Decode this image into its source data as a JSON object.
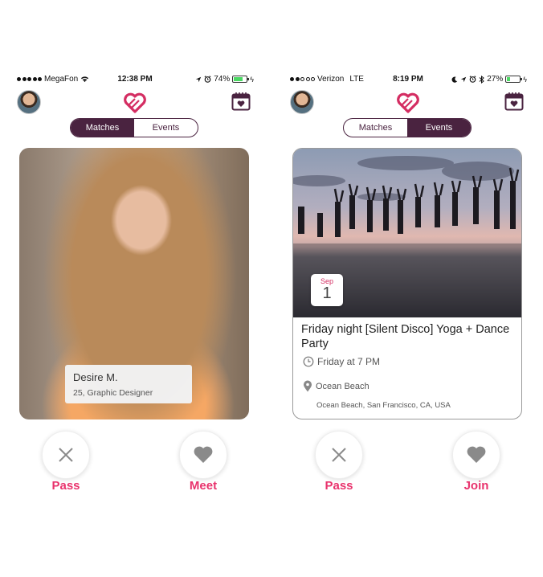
{
  "colors": {
    "brand": "#4a2340",
    "accent": "#e8326c",
    "battery_green": "#4cd964"
  },
  "left": {
    "status": {
      "carrier": "MegaFon",
      "time": "12:38 PM",
      "battery": "74%",
      "battery_level": 0.74
    },
    "segmented": {
      "matches": "Matches",
      "events": "Events",
      "active": "matches"
    },
    "profile": {
      "name": "Desire M.",
      "details": "25, Graphic Designer"
    },
    "actions": {
      "pass_label": "Pass",
      "meet_label": "Meet"
    }
  },
  "right": {
    "status": {
      "carrier": "Verizon",
      "network": "LTE",
      "time": "8:19 PM",
      "battery": "27%",
      "battery_level": 0.27
    },
    "segmented": {
      "matches": "Matches",
      "events": "Events",
      "active": "events"
    },
    "event": {
      "month": "Sep",
      "day": "1",
      "title": "Friday night [Silent Disco] Yoga + Dance Party",
      "time": "Friday at 7 PM",
      "venue": "Ocean Beach",
      "address": "Ocean Beach, San Francisco, CA, USA"
    },
    "actions": {
      "pass_label": "Pass",
      "join_label": "Join"
    }
  },
  "icons": [
    "wifi-icon",
    "location-arrow-icon",
    "alarm-icon",
    "moon-icon",
    "bluetooth-icon",
    "battery-icon",
    "heart-logo-icon",
    "calendar-heart-icon",
    "close-icon",
    "heart-icon",
    "clock-icon",
    "map-pin-icon"
  ]
}
